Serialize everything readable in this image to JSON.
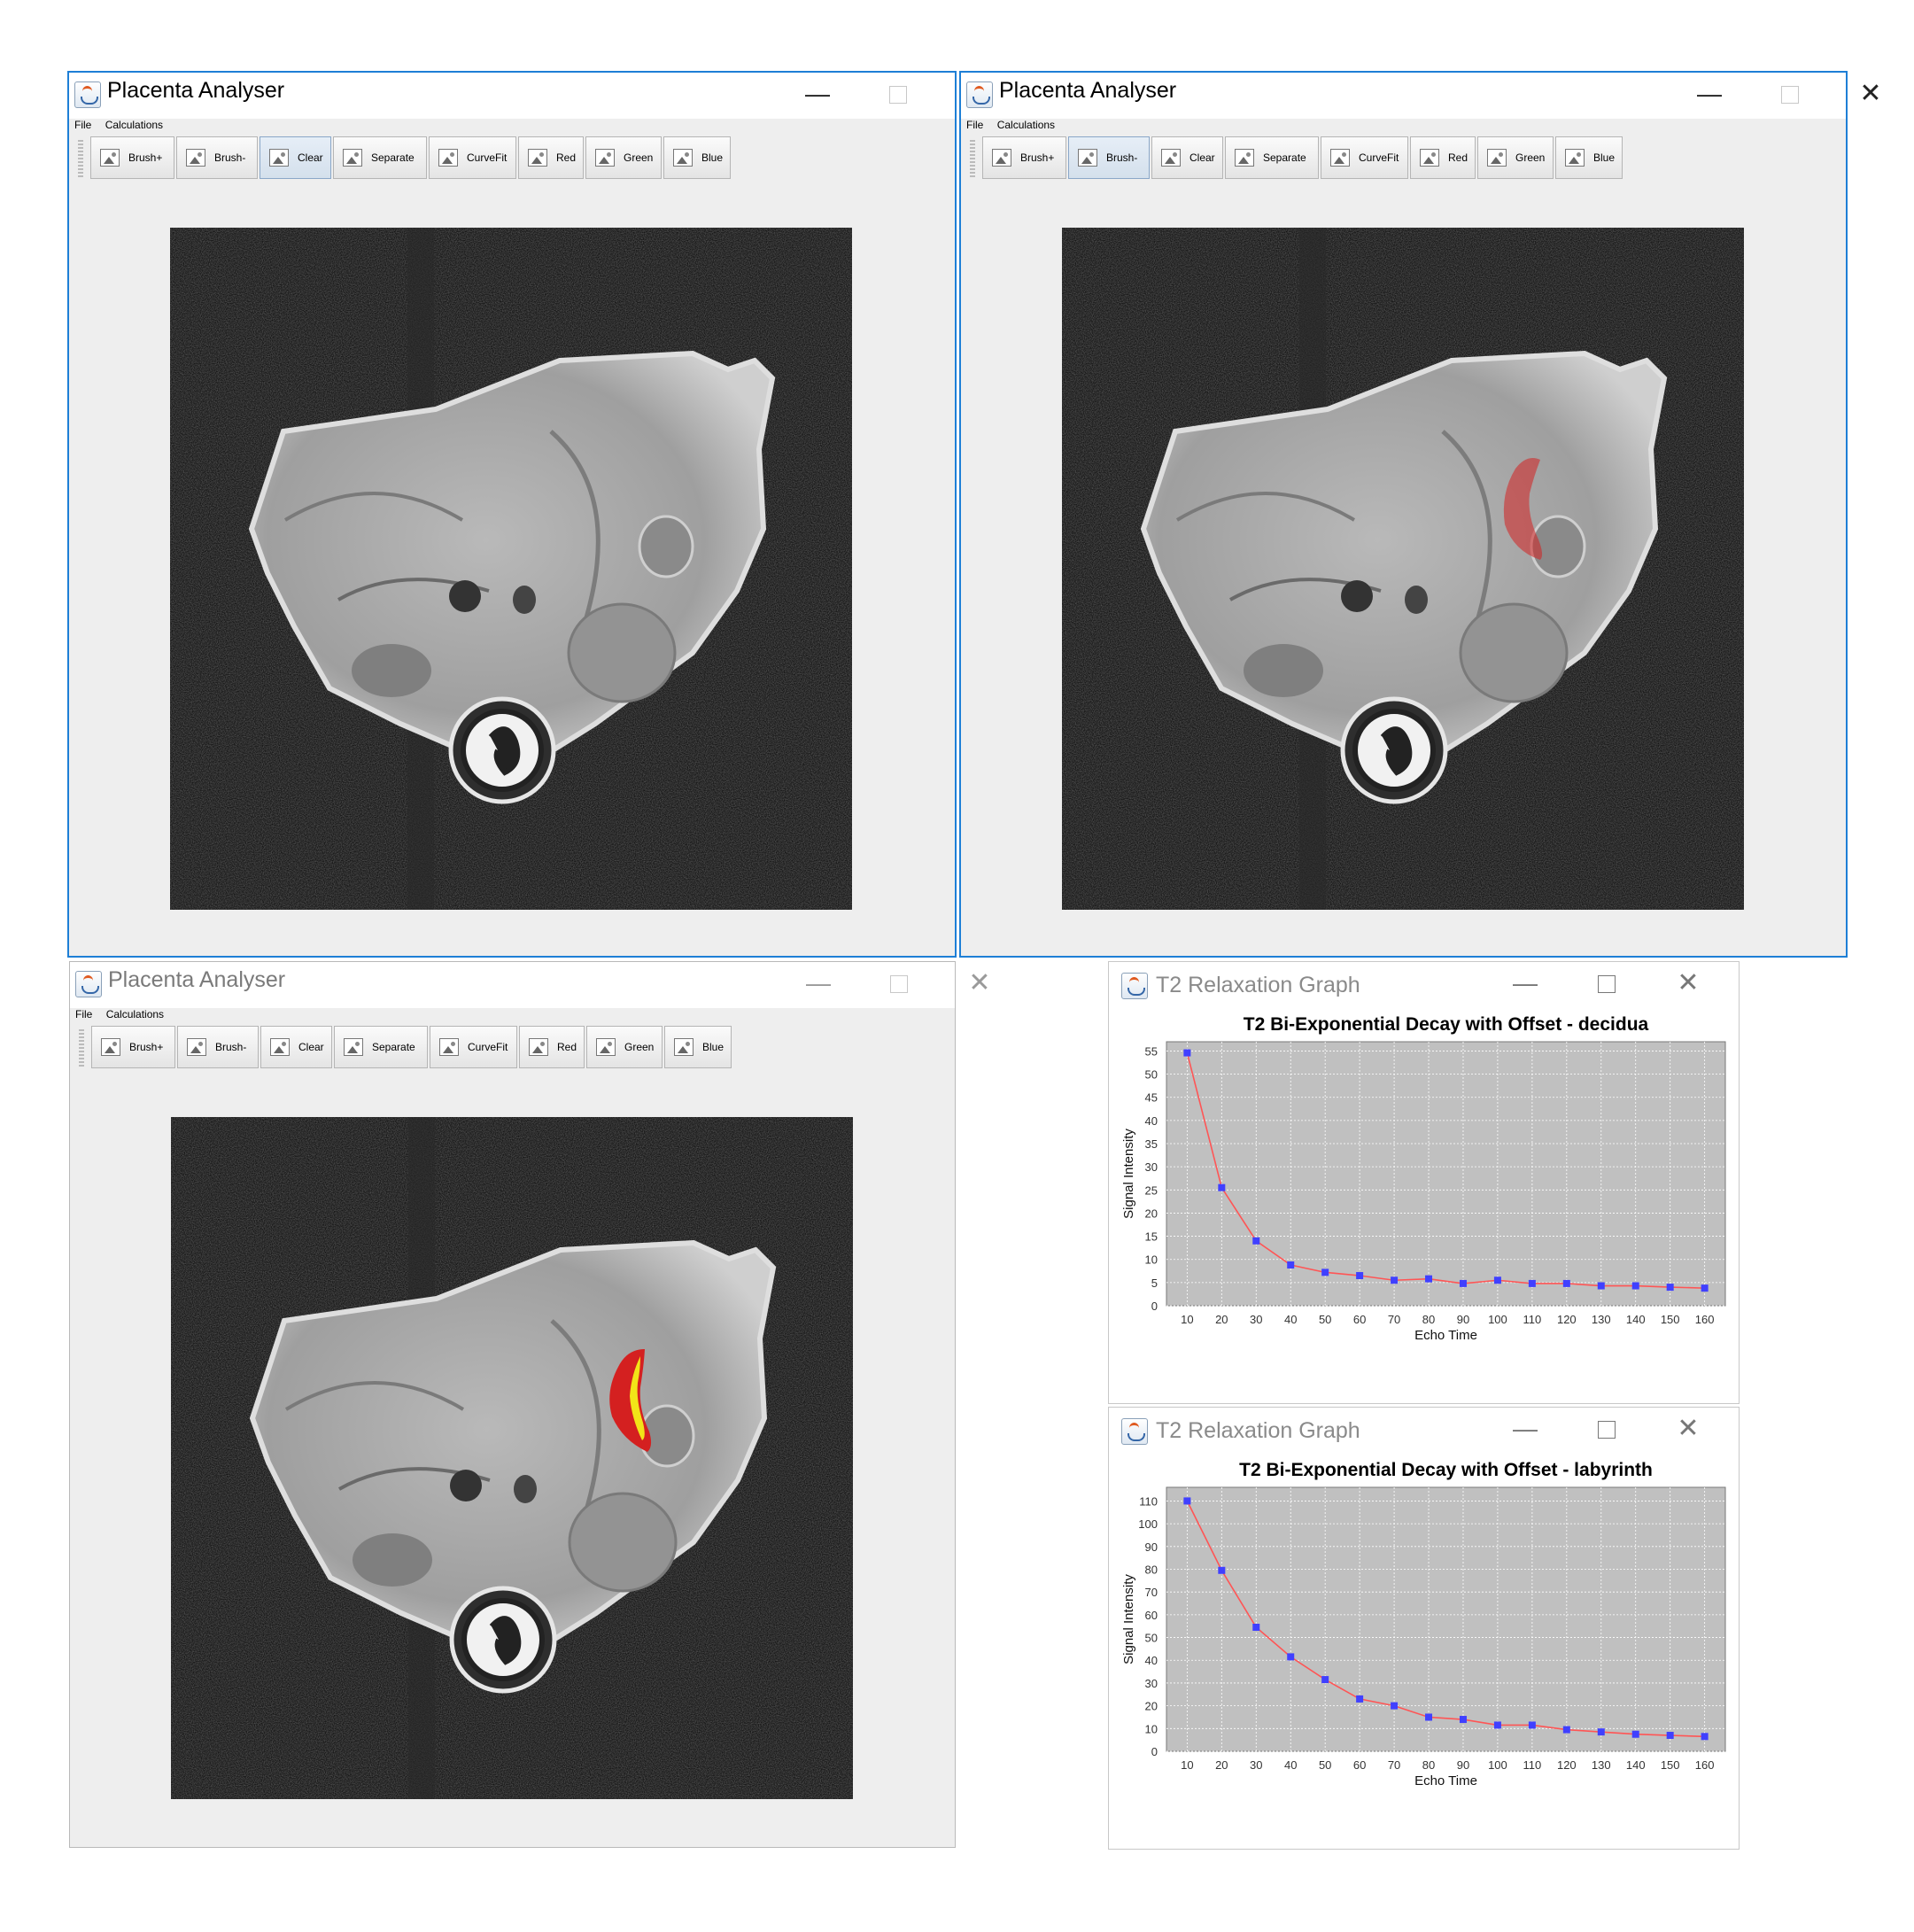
{
  "windows": [
    {
      "title": "Placenta Analyser",
      "menu": [
        "File",
        "Calculations"
      ],
      "toolbar": [
        "Brush+",
        "Brush-",
        "Clear",
        "Separate",
        "CurveFit",
        "Red",
        "Green",
        "Blue"
      ],
      "pressed_button": "Clear",
      "overlay": "none"
    },
    {
      "title": "Placenta Analyser",
      "menu": [
        "File",
        "Calculations"
      ],
      "toolbar": [
        "Brush+",
        "Brush-",
        "Clear",
        "Separate",
        "CurveFit",
        "Red",
        "Green",
        "Blue"
      ],
      "pressed_button": "Brush-",
      "overlay": "red-region"
    },
    {
      "title": "Placenta Analyser",
      "menu": [
        "File",
        "Calculations"
      ],
      "toolbar": [
        "Brush+",
        "Brush-",
        "Clear",
        "Separate",
        "CurveFit",
        "Red",
        "Green",
        "Blue"
      ],
      "pressed_button": "",
      "overlay": "red-yellow-segmentation"
    }
  ],
  "graphs": [
    {
      "window_title": "T2 Relaxation Graph"
    },
    {
      "window_title": "T2 Relaxation Graph"
    }
  ],
  "colors": {
    "active_border": "#1e7fd6",
    "plot_bg": "#c0c0c0",
    "curve": "#ff5555",
    "points": "#4040ff",
    "overlay_red": "#d42020",
    "overlay_yellow": "#f2e418"
  },
  "chart_data": [
    {
      "type": "line",
      "title": "T2 Bi-Exponential Decay with Offset - decidua",
      "xlabel": "Echo Time",
      "ylabel": "Signal Intensity",
      "x": [
        10,
        20,
        30,
        40,
        50,
        60,
        70,
        80,
        90,
        100,
        110,
        120,
        130,
        140,
        150,
        160
      ],
      "series": [
        {
          "values": [
            54.6,
            25.5,
            14.0,
            8.8,
            7.2,
            6.5,
            5.5,
            5.8,
            4.8,
            5.5,
            4.8,
            4.8,
            4.3,
            4.3,
            4.0,
            3.8
          ]
        }
      ],
      "ylim": [
        0,
        57
      ],
      "xlim": [
        4,
        166
      ],
      "yticks": [
        0,
        5,
        10,
        15,
        20,
        25,
        30,
        35,
        40,
        45,
        50,
        55
      ],
      "xticks": [
        10,
        20,
        30,
        40,
        50,
        60,
        70,
        80,
        90,
        100,
        110,
        120,
        130,
        140,
        150,
        160
      ],
      "grid": true
    },
    {
      "type": "line",
      "title": "T2 Bi-Exponential Decay with Offset - labyrinth",
      "xlabel": "Echo Time",
      "ylabel": "Signal Intensity",
      "x": [
        10,
        20,
        30,
        40,
        50,
        60,
        70,
        80,
        90,
        100,
        110,
        120,
        130,
        140,
        150,
        160
      ],
      "series": [
        {
          "values": [
            110.0,
            79.5,
            54.5,
            41.5,
            31.5,
            23.0,
            20.0,
            15.0,
            14.0,
            11.5,
            11.5,
            9.5,
            8.5,
            7.5,
            7.0,
            6.5
          ]
        }
      ],
      "ylim": [
        0,
        116
      ],
      "xlim": [
        4,
        166
      ],
      "yticks": [
        0,
        10,
        20,
        30,
        40,
        50,
        60,
        70,
        80,
        90,
        100,
        110
      ],
      "xticks": [
        10,
        20,
        30,
        40,
        50,
        60,
        70,
        80,
        90,
        100,
        110,
        120,
        130,
        140,
        150,
        160
      ],
      "grid": true
    }
  ]
}
